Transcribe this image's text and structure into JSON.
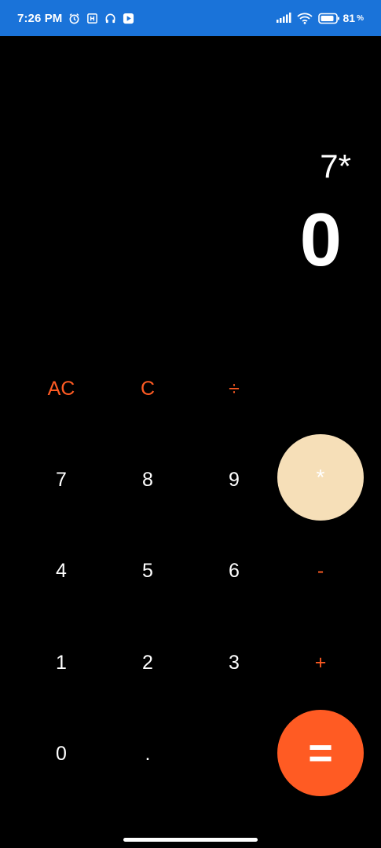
{
  "status_bar": {
    "time": "7:26 PM",
    "icons_left": [
      "alarm-icon",
      "data-saver-icon",
      "headphones-icon",
      "play-icon"
    ],
    "icons_right": [
      "signal-icon",
      "wifi-icon",
      "battery-icon"
    ],
    "battery": "81",
    "battery_unit": "%"
  },
  "display": {
    "expression": "7*",
    "result": "0"
  },
  "keys": {
    "ac": "AC",
    "c": "C",
    "divide": "÷",
    "seven": "7",
    "eight": "8",
    "nine": "9",
    "multiply": "*",
    "four": "4",
    "five": "5",
    "six": "6",
    "minus": "-",
    "one": "1",
    "two": "2",
    "three": "3",
    "plus": "+",
    "zero": "0",
    "dot": ".",
    "equals": "="
  },
  "colors": {
    "status_bar": "#1a73d9",
    "background": "#000000",
    "accent": "#ff5b23",
    "multiply_button": "#f6dfb8",
    "text": "#ffffff"
  }
}
